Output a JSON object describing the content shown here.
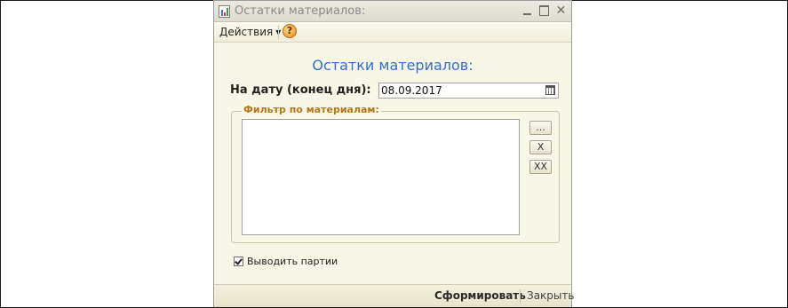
{
  "window": {
    "title": "Остатки материалов:",
    "controls": {
      "minimize": "minimize",
      "maximize": "maximize",
      "close": "✕"
    }
  },
  "toolbar": {
    "actions_label": "Действия",
    "help_label": "?"
  },
  "form": {
    "header": "Остатки материалов:",
    "date_label": "На дату (конец дня):",
    "date_value": "08.09.2017",
    "filter": {
      "legend": "Фильтр по материалам:",
      "items": [],
      "select_button": "...",
      "remove_button": "X",
      "clear_button": "XX"
    },
    "show_batches": {
      "label": "Выводить партии",
      "checked": true
    }
  },
  "footer": {
    "run_button": "Сформировать",
    "close_button": "Закрыть"
  },
  "colors": {
    "window_bg": "#f8f6e6",
    "header_text": "#2f6fd6",
    "legend_text": "#b07a1c"
  },
  "icons": [
    "report-icon",
    "help-icon",
    "calendar-icon",
    "checkbox-tick-icon",
    "caret-down-icon"
  ]
}
